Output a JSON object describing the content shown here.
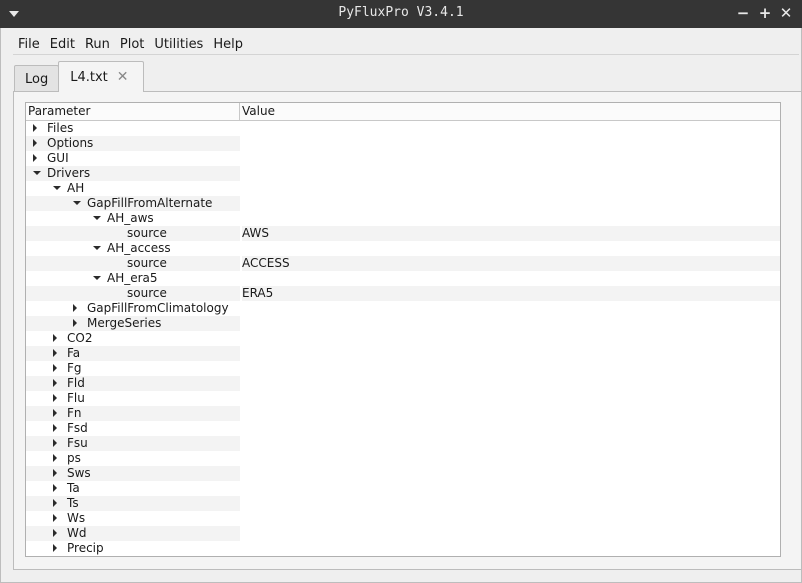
{
  "window": {
    "title": "PyFluxPro V3.4.1",
    "buttons": {
      "minimize": "−",
      "maximize": "+",
      "close": "✕"
    }
  },
  "menubar": [
    "File",
    "Edit",
    "Run",
    "Plot",
    "Utilities",
    "Help"
  ],
  "tabs": [
    {
      "label": "Log",
      "active": false
    },
    {
      "label": "L4.txt",
      "active": true,
      "closable": true
    }
  ],
  "tree": {
    "columns": {
      "parameter": "Parameter",
      "value": "Value"
    },
    "rows": [
      {
        "label": "Files",
        "depth": 0,
        "state": "collapsed",
        "value": ""
      },
      {
        "label": "Options",
        "depth": 0,
        "state": "collapsed",
        "value": ""
      },
      {
        "label": "GUI",
        "depth": 0,
        "state": "collapsed",
        "value": ""
      },
      {
        "label": "Drivers",
        "depth": 0,
        "state": "expanded",
        "value": ""
      },
      {
        "label": "AH",
        "depth": 1,
        "state": "expanded",
        "value": ""
      },
      {
        "label": "GapFillFromAlternate",
        "depth": 2,
        "state": "expanded",
        "value": ""
      },
      {
        "label": "AH_aws",
        "depth": 3,
        "state": "expanded",
        "value": ""
      },
      {
        "label": "source",
        "depth": 4,
        "state": "leaf",
        "value": "AWS"
      },
      {
        "label": "AH_access",
        "depth": 3,
        "state": "expanded",
        "value": ""
      },
      {
        "label": "source",
        "depth": 4,
        "state": "leaf",
        "value": "ACCESS"
      },
      {
        "label": "AH_era5",
        "depth": 3,
        "state": "expanded",
        "value": ""
      },
      {
        "label": "source",
        "depth": 4,
        "state": "leaf",
        "value": "ERA5"
      },
      {
        "label": "GapFillFromClimatology",
        "depth": 2,
        "state": "collapsed",
        "value": ""
      },
      {
        "label": "MergeSeries",
        "depth": 2,
        "state": "collapsed",
        "value": ""
      },
      {
        "label": "CO2",
        "depth": 1,
        "state": "collapsed",
        "value": ""
      },
      {
        "label": "Fa",
        "depth": 1,
        "state": "collapsed",
        "value": ""
      },
      {
        "label": "Fg",
        "depth": 1,
        "state": "collapsed",
        "value": ""
      },
      {
        "label": "Fld",
        "depth": 1,
        "state": "collapsed",
        "value": ""
      },
      {
        "label": "Flu",
        "depth": 1,
        "state": "collapsed",
        "value": ""
      },
      {
        "label": "Fn",
        "depth": 1,
        "state": "collapsed",
        "value": ""
      },
      {
        "label": "Fsd",
        "depth": 1,
        "state": "collapsed",
        "value": ""
      },
      {
        "label": "Fsu",
        "depth": 1,
        "state": "collapsed",
        "value": ""
      },
      {
        "label": "ps",
        "depth": 1,
        "state": "collapsed",
        "value": ""
      },
      {
        "label": "Sws",
        "depth": 1,
        "state": "collapsed",
        "value": ""
      },
      {
        "label": "Ta",
        "depth": 1,
        "state": "collapsed",
        "value": ""
      },
      {
        "label": "Ts",
        "depth": 1,
        "state": "collapsed",
        "value": ""
      },
      {
        "label": "Ws",
        "depth": 1,
        "state": "collapsed",
        "value": ""
      },
      {
        "label": "Wd",
        "depth": 1,
        "state": "collapsed",
        "value": ""
      },
      {
        "label": "Precip",
        "depth": 1,
        "state": "collapsed",
        "value": ""
      }
    ]
  }
}
